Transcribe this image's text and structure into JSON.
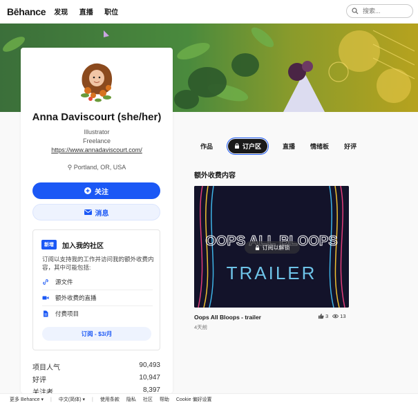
{
  "header": {
    "logo": "Bēhance",
    "nav": [
      "发现",
      "直播",
      "职位"
    ],
    "search_placeholder": "搜索..."
  },
  "profile": {
    "name": "Anna Daviscourt (she/her)",
    "occupation": "Illustrator",
    "status": "Freelance",
    "website": "https://www.annadaviscourt.com/",
    "location": "Portland, OR, USA",
    "follow_label": "关注",
    "message_label": "消息"
  },
  "subscription": {
    "badge": "新增",
    "title": "加入我的社区",
    "description": "订阅以支持我的工作并访问我的额外收费内容，其中可能包括:",
    "perks": [
      "源文件",
      "额外收费的直播",
      "付费项目"
    ],
    "subscribe_label": "订阅 - $3/月"
  },
  "stats": [
    {
      "label": "项目人气",
      "value": "90,493"
    },
    {
      "label": "好评",
      "value": "10,947"
    },
    {
      "label": "关注者",
      "value": "8,397"
    }
  ],
  "tabs": [
    "作品",
    "订户区",
    "直播",
    "情绪板",
    "好评"
  ],
  "active_tab": "订户区",
  "section_title": "额外收费内容",
  "project": {
    "thumb_title": "OOPS ALL BLOOPS",
    "thumb_subtitle": "TRAILER",
    "unlock_label": "订阅以解锁",
    "title": "Oops All Bloops - trailer",
    "time": "4天前",
    "likes": "3",
    "views": "13"
  },
  "footer": [
    "更多 Behance ▾",
    "中文(简体) ▾",
    "使用条款",
    "隐私",
    "社区",
    "帮助",
    "Cookie 偏好设置"
  ],
  "colors": {
    "accent": "#1b58f5",
    "dark": "#191919"
  }
}
